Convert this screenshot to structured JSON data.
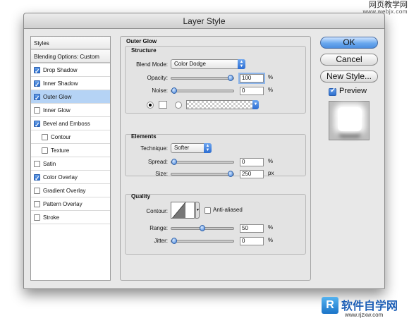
{
  "watermark": {
    "cn": "网页教学网",
    "url": "www.webjx.com"
  },
  "window": {
    "title": "Layer Style"
  },
  "sidebar": {
    "header": "Styles",
    "blending": "Blending Options: Custom",
    "items": [
      {
        "label": "Drop Shadow",
        "checked": true,
        "indent": false,
        "selected": false
      },
      {
        "label": "Inner Shadow",
        "checked": true,
        "indent": false,
        "selected": false
      },
      {
        "label": "Outer Glow",
        "checked": true,
        "indent": false,
        "selected": true
      },
      {
        "label": "Inner Glow",
        "checked": false,
        "indent": false,
        "selected": false
      },
      {
        "label": "Bevel and Emboss",
        "checked": true,
        "indent": false,
        "selected": false
      },
      {
        "label": "Contour",
        "checked": false,
        "indent": true,
        "selected": false
      },
      {
        "label": "Texture",
        "checked": false,
        "indent": true,
        "selected": false
      },
      {
        "label": "Satin",
        "checked": false,
        "indent": false,
        "selected": false
      },
      {
        "label": "Color Overlay",
        "checked": true,
        "indent": false,
        "selected": false
      },
      {
        "label": "Gradient Overlay",
        "checked": false,
        "indent": false,
        "selected": false
      },
      {
        "label": "Pattern Overlay",
        "checked": false,
        "indent": false,
        "selected": false
      },
      {
        "label": "Stroke",
        "checked": false,
        "indent": false,
        "selected": false
      }
    ]
  },
  "outer_glow": {
    "title": "Outer Glow",
    "structure": {
      "title": "Structure",
      "blend_mode_label": "Blend Mode:",
      "blend_mode": "Color Dodge",
      "opacity_label": "Opacity:",
      "opacity": "100",
      "opacity_level": 1.0,
      "noise_label": "Noise:",
      "noise": "0",
      "noise_level": 0.0,
      "unit": "%"
    },
    "elements": {
      "title": "Elements",
      "technique_label": "Technique:",
      "technique": "Softer",
      "spread_label": "Spread:",
      "spread": "0",
      "spread_level": 0.0,
      "spread_unit": "%",
      "size_label": "Size:",
      "size": "250",
      "size_level": 1.0,
      "size_unit": "px"
    },
    "quality": {
      "title": "Quality",
      "contour_label": "Contour:",
      "anti_aliased": "Anti-aliased",
      "range_label": "Range:",
      "range": "50",
      "range_level": 0.5,
      "jitter_label": "Jitter:",
      "jitter": "0",
      "jitter_level": 0.0,
      "unit": "%"
    }
  },
  "buttons": {
    "ok": "OK",
    "cancel": "Cancel",
    "new_style": "New Style...",
    "preview": "Preview"
  },
  "logo": {
    "cn": "软件自学网",
    "url": "www.rjzxw.com",
    "mark": "R"
  },
  "colors": {
    "selection": "#b5d3f5",
    "accent": "#3f7fd8"
  }
}
